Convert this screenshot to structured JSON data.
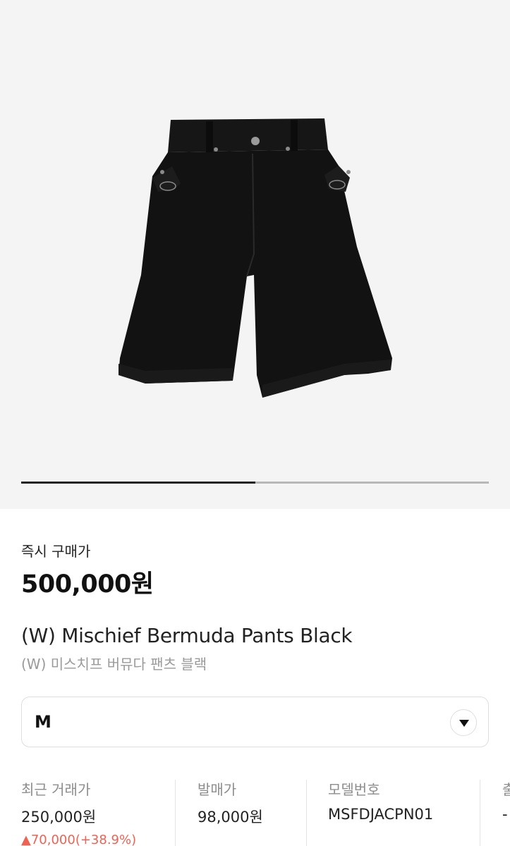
{
  "gallery": {
    "image_alt": "(W) Mischief Bermuda Pants Black",
    "slide_progress": 0.5
  },
  "purchase": {
    "label": "즉시 구매가",
    "price": "500,000원"
  },
  "product": {
    "name_en": "(W) Mischief Bermuda Pants Black",
    "name_ko": "(W) 미스치프 버뮤다 팬츠 블랙"
  },
  "size_select": {
    "value": "M",
    "icon": "caret-down-icon"
  },
  "info": {
    "recent": {
      "label": "최근 거래가",
      "value": "250,000원",
      "change": "▲70,000(+38.9%)",
      "change_color": "#ef6253"
    },
    "release": {
      "label": "발매가",
      "value": "98,000원"
    },
    "model": {
      "label": "모델번호",
      "value": "MSFDJACPN01"
    },
    "fourth": {
      "label": "출",
      "value": "-"
    }
  }
}
